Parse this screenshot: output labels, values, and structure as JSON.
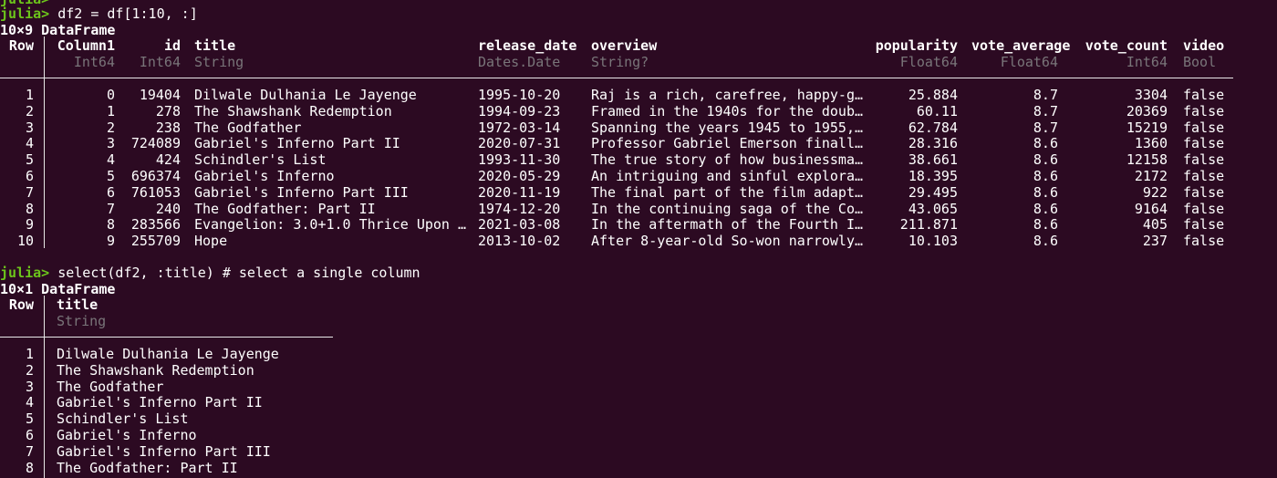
{
  "colors": {
    "background": "#2c0a22",
    "prompt": "#6cc41b",
    "text": "#ffffff",
    "type_text": "#797579",
    "rule": "#e8e8e8"
  },
  "session": {
    "prev_prompt": "julia>",
    "prompt": "julia>",
    "cmd1": " df2 = df[1:10, :]",
    "cmd2": " select(df2, :title) # select a single column"
  },
  "table1": {
    "summary": "10×9 DataFrame",
    "row_header": "Row",
    "columns": [
      {
        "name": "Column1",
        "type": "Int64",
        "align": "right"
      },
      {
        "name": "id",
        "type": "Int64",
        "align": "right"
      },
      {
        "name": "title",
        "type": "String",
        "align": "left"
      },
      {
        "name": "release_date",
        "type": "Dates.Date",
        "align": "left"
      },
      {
        "name": "overview",
        "type": "String?",
        "align": "left"
      },
      {
        "name": "popularity",
        "type": "Float64",
        "align": "right"
      },
      {
        "name": "vote_average",
        "type": "Float64",
        "align": "right"
      },
      {
        "name": "vote_count",
        "type": "Int64",
        "align": "right"
      },
      {
        "name": "video",
        "type": "Bool",
        "align": "left"
      }
    ],
    "rows": [
      {
        "row": "1",
        "cells": [
          "0",
          "19404",
          "Dilwale Dulhania Le Jayenge",
          "1995-10-20",
          "Raj is a rich, carefree, happy-g…",
          "25.884",
          "8.7",
          "3304",
          "false"
        ]
      },
      {
        "row": "2",
        "cells": [
          "1",
          "278",
          "The Shawshank Redemption",
          "1994-09-23",
          "Framed in the 1940s for the doub…",
          "60.11",
          "8.7",
          "20369",
          "false"
        ]
      },
      {
        "row": "3",
        "cells": [
          "2",
          "238",
          "The Godfather",
          "1972-03-14",
          "Spanning the years 1945 to 1955,…",
          "62.784",
          "8.7",
          "15219",
          "false"
        ]
      },
      {
        "row": "4",
        "cells": [
          "3",
          "724089",
          "Gabriel's Inferno Part II",
          "2020-07-31",
          "Professor Gabriel Emerson finall…",
          "28.316",
          "8.6",
          "1360",
          "false"
        ]
      },
      {
        "row": "5",
        "cells": [
          "4",
          "424",
          "Schindler's List",
          "1993-11-30",
          "The true story of how businessma…",
          "38.661",
          "8.6",
          "12158",
          "false"
        ]
      },
      {
        "row": "6",
        "cells": [
          "5",
          "696374",
          "Gabriel's Inferno",
          "2020-05-29",
          "An intriguing and sinful explora…",
          "18.395",
          "8.6",
          "2172",
          "false"
        ]
      },
      {
        "row": "7",
        "cells": [
          "6",
          "761053",
          "Gabriel's Inferno Part III",
          "2020-11-19",
          "The final part of the film adapt…",
          "29.495",
          "8.6",
          "922",
          "false"
        ]
      },
      {
        "row": "8",
        "cells": [
          "7",
          "240",
          "The Godfather: Part II",
          "1974-12-20",
          "In the continuing saga of the Co…",
          "43.065",
          "8.6",
          "9164",
          "false"
        ]
      },
      {
        "row": "9",
        "cells": [
          "8",
          "283566",
          "Evangelion: 3.0+1.0 Thrice Upon …",
          "2021-03-08",
          "In the aftermath of the Fourth I…",
          "211.871",
          "8.6",
          "405",
          "false"
        ]
      },
      {
        "row": "10",
        "cells": [
          "9",
          "255709",
          "Hope",
          "2013-10-02",
          "After 8-year-old So-won narrowly…",
          "10.103",
          "8.6",
          "237",
          "false"
        ]
      }
    ]
  },
  "table2": {
    "summary": "10×1 DataFrame",
    "row_header": "Row",
    "column": {
      "name": "title",
      "type": "String"
    },
    "rows": [
      {
        "row": "1",
        "title": "Dilwale Dulhania Le Jayenge"
      },
      {
        "row": "2",
        "title": "The Shawshank Redemption"
      },
      {
        "row": "3",
        "title": "The Godfather"
      },
      {
        "row": "4",
        "title": "Gabriel's Inferno Part II"
      },
      {
        "row": "5",
        "title": "Schindler's List"
      },
      {
        "row": "6",
        "title": "Gabriel's Inferno"
      },
      {
        "row": "7",
        "title": "Gabriel's Inferno Part III"
      },
      {
        "row": "8",
        "title": "The Godfather: Part II"
      }
    ]
  }
}
